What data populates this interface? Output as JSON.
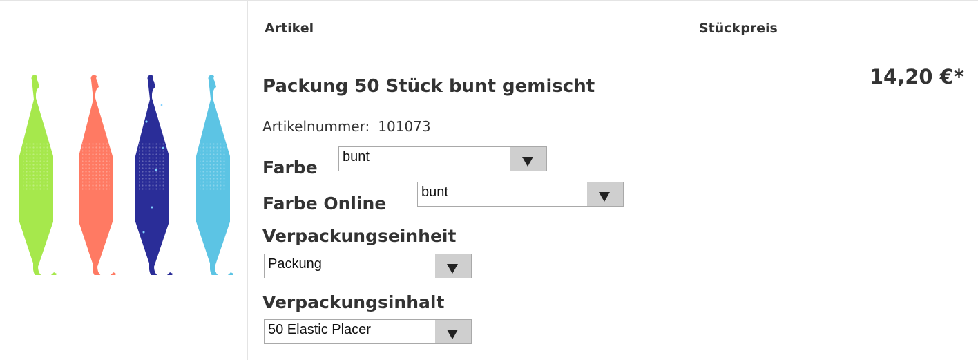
{
  "header": {
    "col_article": "Artikel",
    "col_price": "Stückpreis"
  },
  "product": {
    "image_icon": "elastic-placer-tools-image",
    "image_colors": [
      "#a6e84c",
      "#ff7a63",
      "#2a2d98",
      "#5cc4e4"
    ],
    "title": "Packung 50 Stück bunt gemischt",
    "artno_label": "Artikelnummer:",
    "artno_value": "101073",
    "farbe_label": "Farbe",
    "farbe_value": "bunt",
    "farbe_online_label": "Farbe Online",
    "farbe_online_value": "bunt",
    "verpackungseinheit_label": "Verpackungseinheit",
    "verpackungseinheit_value": "Packung",
    "verpackungsinhalt_label": "Verpackungsinhalt",
    "verpackungsinhalt_value": "50 Elastic Placer",
    "price": "14,20 €*"
  }
}
